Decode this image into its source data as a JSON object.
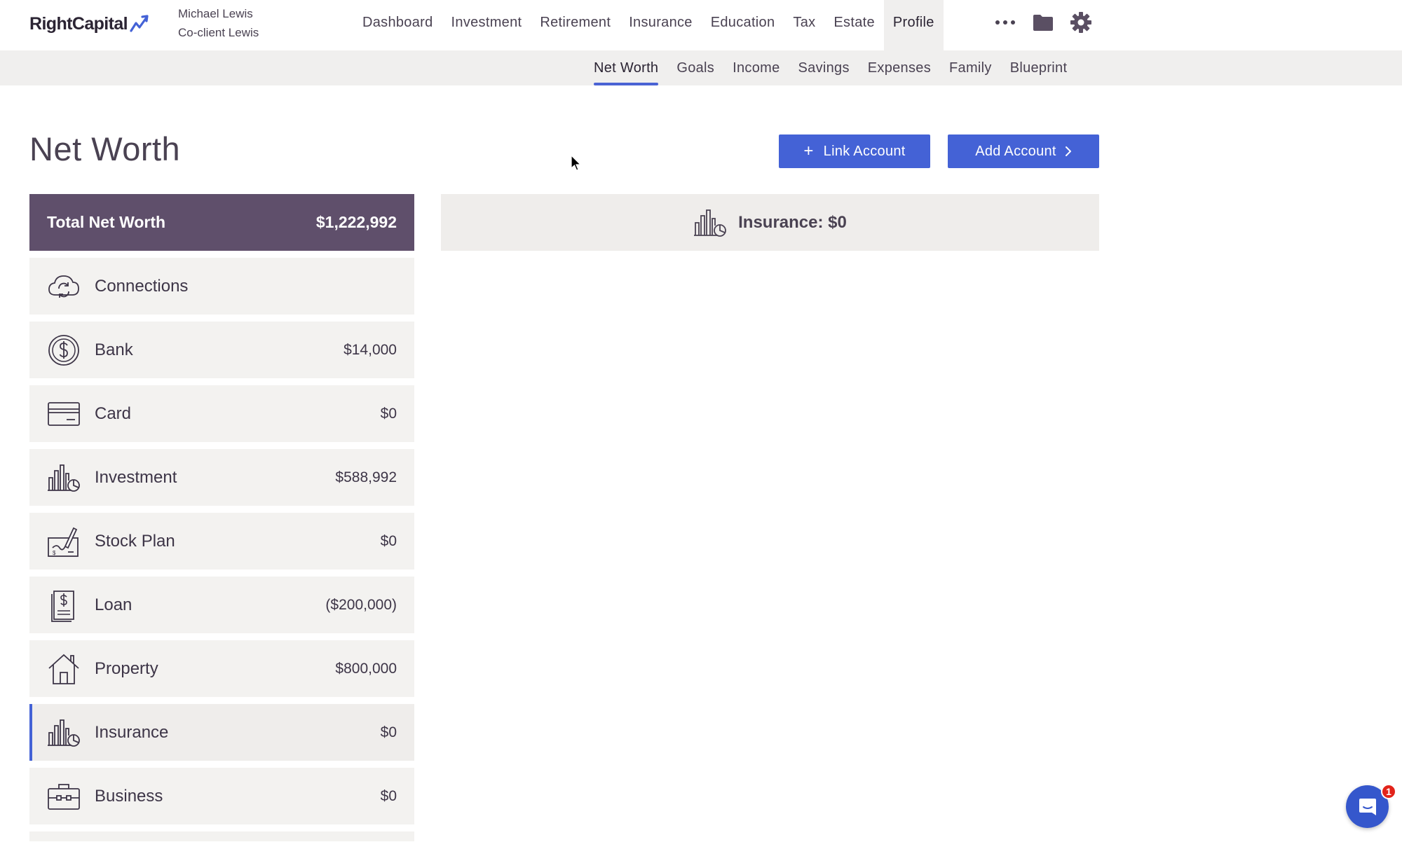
{
  "brand": {
    "name": "RightCapital",
    "accent": "#4462d6",
    "dark": "#5f4f6b"
  },
  "client": {
    "primary": "Michael Lewis",
    "secondary": "Co-client Lewis"
  },
  "main_nav": [
    {
      "label": "Dashboard"
    },
    {
      "label": "Investment"
    },
    {
      "label": "Retirement"
    },
    {
      "label": "Insurance"
    },
    {
      "label": "Education"
    },
    {
      "label": "Tax"
    },
    {
      "label": "Estate"
    },
    {
      "label": "Profile",
      "active": true
    }
  ],
  "nav_icons": [
    "more-icon",
    "folder-icon",
    "gear-icon"
  ],
  "sub_nav": [
    {
      "label": "Net Worth",
      "active": true
    },
    {
      "label": "Goals"
    },
    {
      "label": "Income"
    },
    {
      "label": "Savings"
    },
    {
      "label": "Expenses"
    },
    {
      "label": "Family"
    },
    {
      "label": "Blueprint"
    }
  ],
  "page": {
    "title": "Net Worth",
    "link_account_label": "Link Account",
    "add_account_label": "Add Account"
  },
  "summary": {
    "label": "Total Net Worth",
    "value": "$1,222,992"
  },
  "categories": [
    {
      "label": "Connections",
      "value": "",
      "icon": "cloud-sync-icon"
    },
    {
      "label": "Bank",
      "value": "$14,000",
      "icon": "dollar-coin-icon"
    },
    {
      "label": "Card",
      "value": "$0",
      "icon": "credit-card-icon"
    },
    {
      "label": "Investment",
      "value": "$588,992",
      "icon": "investment-chart-icon"
    },
    {
      "label": "Stock Plan",
      "value": "$0",
      "icon": "stock-plan-icon"
    },
    {
      "label": "Loan",
      "value": "($200,000)",
      "icon": "loan-document-icon"
    },
    {
      "label": "Property",
      "value": "$800,000",
      "icon": "house-icon"
    },
    {
      "label": "Insurance",
      "value": "$0",
      "icon": "insurance-chart-icon",
      "selected": true
    },
    {
      "label": "Business",
      "value": "$0",
      "icon": "briefcase-icon"
    }
  ],
  "detail": {
    "heading": "Insurance: $0"
  },
  "chat": {
    "badge": "1"
  }
}
